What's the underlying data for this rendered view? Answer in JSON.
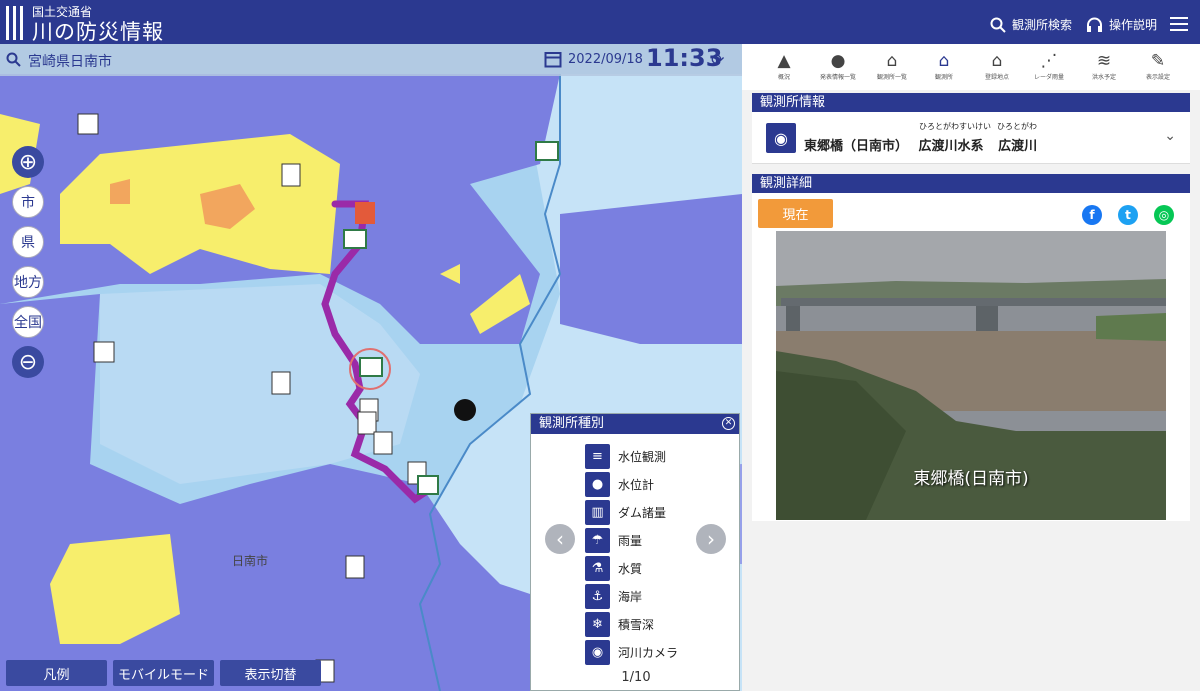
{
  "header": {
    "ministry": "国土交通省",
    "title": "川の防災情報",
    "search_label": "観測所検索",
    "help_label": "操作説明",
    "colors": {
      "bar": "#2b3990"
    }
  },
  "map": {
    "location": "宮崎県日南市",
    "date": "2022/09/18",
    "time": "11:33",
    "zoom_buttons": [
      "市",
      "県",
      "地方",
      "全国"
    ],
    "bottom_buttons": [
      "凡例",
      "モバイルモード",
      "表示切替"
    ],
    "place_labels": [
      "日南市"
    ]
  },
  "legend": {
    "title": "観測所種別",
    "items": [
      {
        "icon": "water-level-icon",
        "label": "水位観測"
      },
      {
        "icon": "water-gauge-icon",
        "label": "水位計"
      },
      {
        "icon": "dam-icon",
        "label": "ダム諸量"
      },
      {
        "icon": "umbrella-icon",
        "label": "雨量"
      },
      {
        "icon": "flask-icon",
        "label": "水質"
      },
      {
        "icon": "anchor-icon",
        "label": "海岸"
      },
      {
        "icon": "snowflake-icon",
        "label": "積雪深"
      },
      {
        "icon": "camera-icon",
        "label": "河川カメラ"
      }
    ],
    "page": "1/10"
  },
  "tabs": [
    {
      "icon": "warning-icon",
      "label": "概況"
    },
    {
      "icon": "alert-icon",
      "label": "発表情報一覧"
    },
    {
      "icon": "station-list-icon",
      "label": "観測所一覧"
    },
    {
      "icon": "home-icon",
      "label": "観測所",
      "active": true
    },
    {
      "icon": "home-point-icon",
      "label": "登録地点"
    },
    {
      "icon": "radar-icon",
      "label": "レーダ雨量"
    },
    {
      "icon": "flood-icon",
      "label": "洪水予定"
    },
    {
      "icon": "wrench-icon",
      "label": "表示設定"
    }
  ],
  "station_info": {
    "heading": "観測所情報",
    "name": "東郷橋（日南市）",
    "system": "広渡川水系",
    "river": "広渡川",
    "system_ruby": "ひろとがわすいけい",
    "river_ruby": "ひろとがわ"
  },
  "detail": {
    "heading": "観測詳細",
    "now_label": "現在",
    "social": [
      {
        "icon": "facebook-icon",
        "color": "#1877f2"
      },
      {
        "icon": "twitter-icon",
        "color": "#1da1f2"
      },
      {
        "icon": "line-icon",
        "color": "#06c755"
      }
    ],
    "photo_caption": "東郷橋(日南市)"
  }
}
